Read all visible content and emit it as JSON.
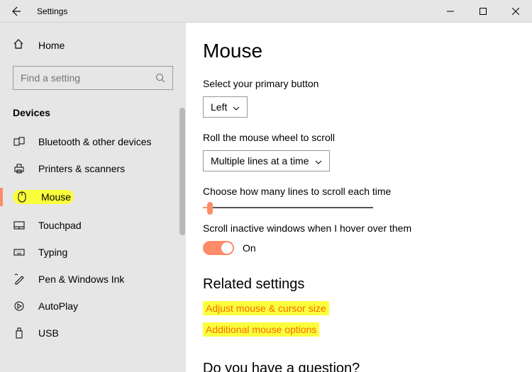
{
  "titlebar": {
    "title": "Settings"
  },
  "sidebar": {
    "home": "Home",
    "search_placeholder": "Find a setting",
    "section": "Devices",
    "items": [
      {
        "label": "Bluetooth & other devices",
        "icon": "bluetooth-devices-icon"
      },
      {
        "label": "Printers & scanners",
        "icon": "printer-icon"
      },
      {
        "label": "Mouse",
        "icon": "mouse-icon"
      },
      {
        "label": "Touchpad",
        "icon": "touchpad-icon"
      },
      {
        "label": "Typing",
        "icon": "keyboard-icon"
      },
      {
        "label": "Pen & Windows Ink",
        "icon": "pen-icon"
      },
      {
        "label": "AutoPlay",
        "icon": "autoplay-icon"
      },
      {
        "label": "USB",
        "icon": "usb-icon"
      }
    ]
  },
  "content": {
    "heading": "Mouse",
    "primary_button_label": "Select your primary button",
    "primary_button_value": "Left",
    "wheel_label": "Roll the mouse wheel to scroll",
    "wheel_value": "Multiple lines at a time",
    "lines_label": "Choose how many lines to scroll each time",
    "inactive_label": "Scroll inactive windows when I hover over them",
    "toggle_state": "On",
    "related_heading": "Related settings",
    "link1": "Adjust mouse & cursor size",
    "link2": "Additional mouse options",
    "question": "Do you have a question?"
  }
}
